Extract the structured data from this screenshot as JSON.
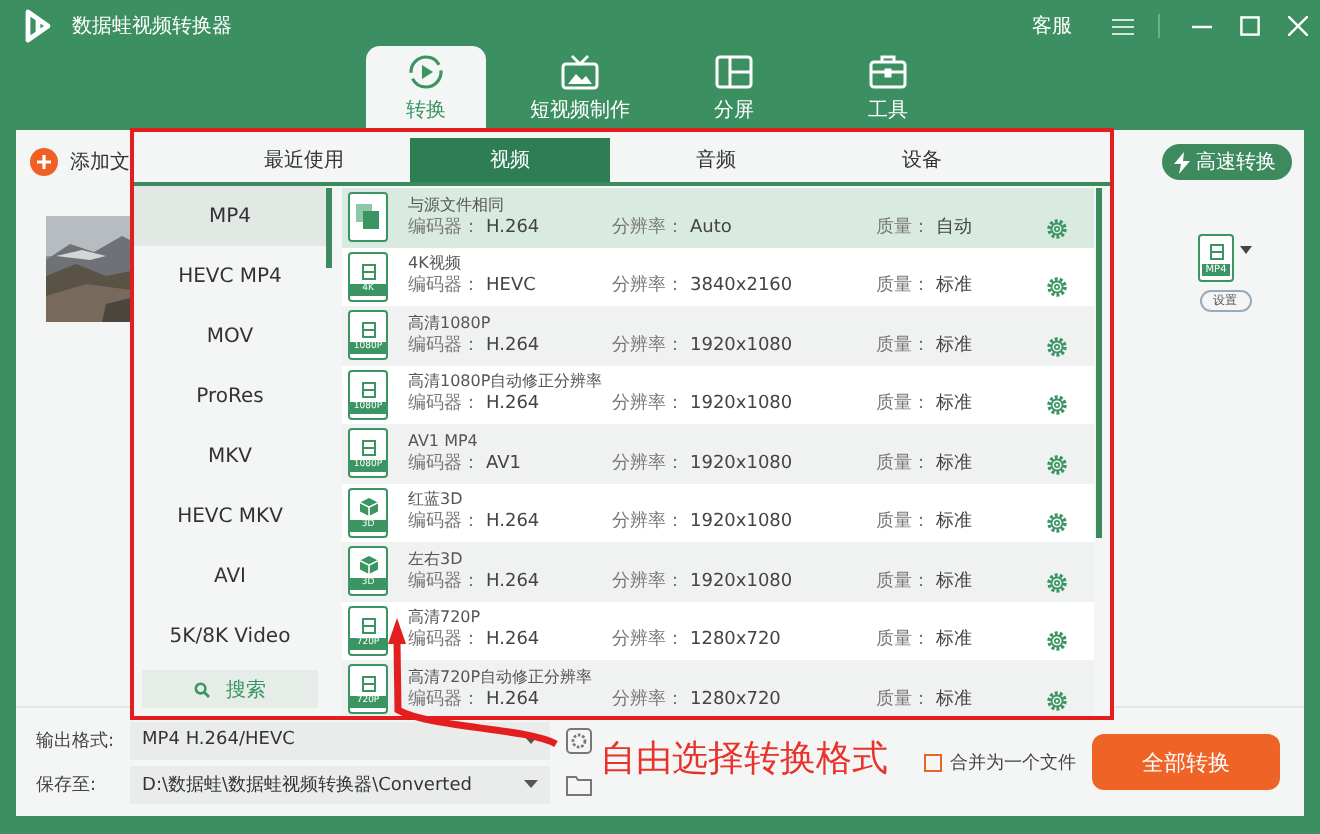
{
  "window": {
    "title": "数据蛙视频转换器",
    "service": "客服"
  },
  "nav_tabs": [
    {
      "label": "转换",
      "selected": true
    },
    {
      "label": "短视频制作",
      "selected": false
    },
    {
      "label": "分屏",
      "selected": false
    },
    {
      "label": "工具",
      "selected": false
    }
  ],
  "toolbar": {
    "add_button": "添加文",
    "fast_button": "高速转换"
  },
  "file_item": {
    "format_badge": "MP4",
    "settings_button": "设置"
  },
  "format_popup": {
    "tabs": [
      {
        "label": "最近使用",
        "selected": false
      },
      {
        "label": "视频",
        "selected": true
      },
      {
        "label": "音频",
        "selected": false
      },
      {
        "label": "设备",
        "selected": false
      }
    ],
    "formats": [
      {
        "label": "MP4",
        "selected": true
      },
      {
        "label": "HEVC MP4",
        "selected": false
      },
      {
        "label": "MOV",
        "selected": false
      },
      {
        "label": "ProRes",
        "selected": false
      },
      {
        "label": "MKV",
        "selected": false
      },
      {
        "label": "HEVC MKV",
        "selected": false
      },
      {
        "label": "AVI",
        "selected": false
      },
      {
        "label": "5K/8K Video",
        "selected": false
      }
    ],
    "search_button": "搜索",
    "presets": [
      {
        "kind": "copy",
        "title": "与源文件相同",
        "codec_label": "编码器：",
        "codec": "H.264",
        "res_label": "分辨率：",
        "resolution": "Auto",
        "quality_label": "质量：",
        "quality": "自动",
        "selected": true
      },
      {
        "kind": "video",
        "badge": "4K",
        "title": "4K视频",
        "codec_label": "编码器：",
        "codec": "HEVC",
        "res_label": "分辨率：",
        "resolution": "3840x2160",
        "quality_label": "质量：",
        "quality": "标准",
        "selected": false
      },
      {
        "kind": "video",
        "badge": "1080P",
        "title": "高清1080P",
        "codec_label": "编码器：",
        "codec": "H.264",
        "res_label": "分辨率：",
        "resolution": "1920x1080",
        "quality_label": "质量：",
        "quality": "标准",
        "selected": false
      },
      {
        "kind": "video",
        "badge": "1080P",
        "title": "高清1080P自动修正分辨率",
        "codec_label": "编码器：",
        "codec": "H.264",
        "res_label": "分辨率：",
        "resolution": "1920x1080",
        "quality_label": "质量：",
        "quality": "标准",
        "selected": false
      },
      {
        "kind": "video",
        "badge": "1080P",
        "title": "AV1 MP4",
        "codec_label": "编码器：",
        "codec": "AV1",
        "res_label": "分辨率：",
        "resolution": "1920x1080",
        "quality_label": "质量：",
        "quality": "标准",
        "selected": false
      },
      {
        "kind": "cube",
        "badge": "3D",
        "title": "红蓝3D",
        "codec_label": "编码器：",
        "codec": "H.264",
        "res_label": "分辨率：",
        "resolution": "1920x1080",
        "quality_label": "质量：",
        "quality": "标准",
        "selected": false
      },
      {
        "kind": "cube",
        "badge": "3D",
        "title": "左右3D",
        "codec_label": "编码器：",
        "codec": "H.264",
        "res_label": "分辨率：",
        "resolution": "1920x1080",
        "quality_label": "质量：",
        "quality": "标准",
        "selected": false
      },
      {
        "kind": "video",
        "badge": "720P",
        "title": "高清720P",
        "codec_label": "编码器：",
        "codec": "H.264",
        "res_label": "分辨率：",
        "resolution": "1280x720",
        "quality_label": "质量：",
        "quality": "标准",
        "selected": false
      },
      {
        "kind": "video",
        "badge": "720P",
        "title": "高清720P自动修正分辨率",
        "codec_label": "编码器：",
        "codec": "H.264",
        "res_label": "分辨率：",
        "resolution": "1280x720",
        "quality_label": "质量：",
        "quality": "标准",
        "selected": false
      }
    ]
  },
  "bottom_bar": {
    "output_label": "输出格式:",
    "output_value": "MP4 H.264/HEVC",
    "save_label": "保存至:",
    "save_path": "D:\\数据蛙\\数据蛙视频转换器\\Converted",
    "merge": {
      "label": "合并为一个文件",
      "checked": false
    },
    "convert_all": "全部转换"
  },
  "annotation": "自由选择转换格式"
}
